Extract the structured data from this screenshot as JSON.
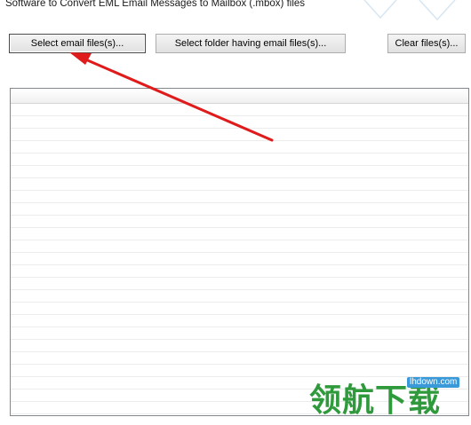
{
  "window": {
    "title": "Software to Convert EML Email Messages to Mailbox (.mbox) files"
  },
  "toolbar": {
    "select_files_label": "Select email files(s)...",
    "select_folder_label": "Select folder having email files(s)...",
    "clear_files_label": "Clear files(s)..."
  },
  "file_list": {
    "rows": []
  },
  "watermark": {
    "site": "lhdown.com",
    "text": "领航下载"
  },
  "colors": {
    "arrow": "#e01b1b",
    "watermark_green": "#2f9a3c",
    "watermark_badge": "#3a9ad9"
  }
}
